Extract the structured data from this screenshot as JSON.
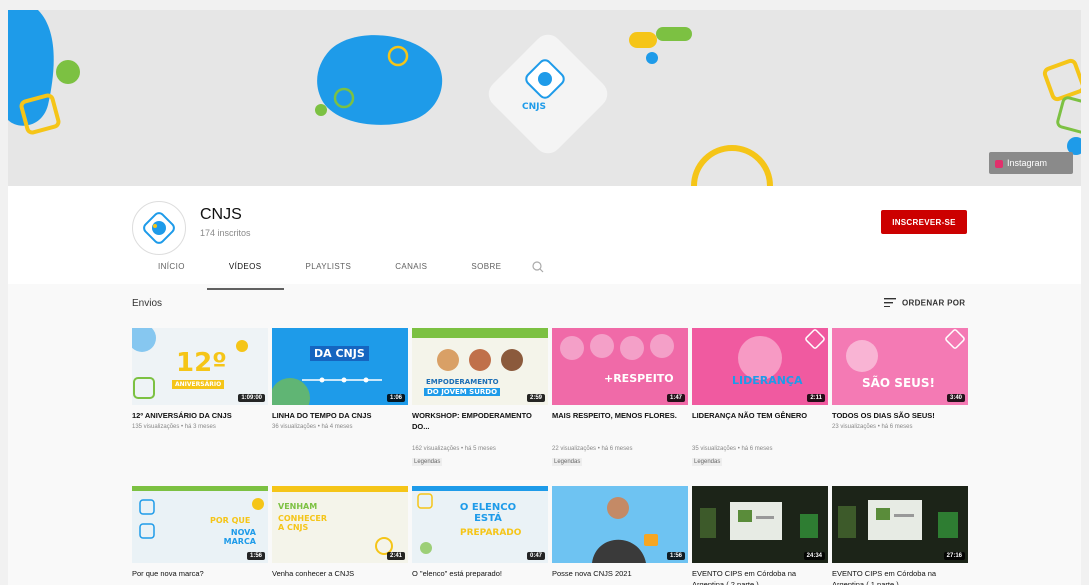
{
  "banner": {
    "logo_text": "CNJS",
    "instagram_label": "Instagram"
  },
  "channel": {
    "name": "CNJS",
    "subscribers": "174 inscritos",
    "subscribe_label": "INSCREVER-SE"
  },
  "tabs": [
    "INÍCIO",
    "VÍDEOS",
    "PLAYLISTS",
    "CANAIS",
    "SOBRE"
  ],
  "section": {
    "title": "Envios",
    "sort_label": "ORDENAR POR"
  },
  "videos": [
    {
      "title": "12º ANIVERSÁRIO DA CNJS",
      "meta": "135 visualizações • há 3 meses",
      "duration": "1:09:00",
      "thumb_text": "12º",
      "thumb_sub": "ANIVERSÁRIO"
    },
    {
      "title": "LINHA DO TEMPO DA CNJS",
      "meta": "36 visualizações • há 4 meses",
      "duration": "1:06",
      "thumb_text": "DA CNJS"
    },
    {
      "title": "WORKSHOP: EMPODERAMENTO DO...",
      "meta": "162 visualizações • há 5 meses",
      "duration": "2:59",
      "cc": "Legendas",
      "thumb_text": "EMPODERAMENTO",
      "thumb_sub": "DO JOVEM SURDO"
    },
    {
      "title": "MAIS RESPEITO, MENOS FLORES.",
      "meta": "22 visualizações • há 6 meses",
      "duration": "1:47",
      "cc": "Legendas",
      "thumb_text": "+RESPEITO"
    },
    {
      "title": "LIDERANÇA NÃO TEM GÊNERO",
      "meta": "35 visualizações • há 6 meses",
      "duration": "2:11",
      "cc": "Legendas",
      "thumb_text": "LIDERANÇA"
    },
    {
      "title": "TODOS OS DIAS SÃO SEUS!",
      "meta": "23 visualizações • há 6 meses",
      "duration": "3:40",
      "thumb_text": "SÃO SEUS!"
    },
    {
      "title": "Por que nova marca?",
      "meta": "",
      "duration": "1:56",
      "thumb_text": "POR QUE",
      "thumb_sub": "NOVA MARCA"
    },
    {
      "title": "Venha conhecer a CNJS",
      "meta": "",
      "duration": "2:41",
      "thumb_text": "VENHAM",
      "thumb_sub": "CONHECER A CNJS"
    },
    {
      "title": "O \"elenco\" está preparado!",
      "meta": "",
      "duration": "0:47",
      "thumb_text": "O ELENCO ESTÁ",
      "thumb_sub": "PREPARADO"
    },
    {
      "title": "Posse nova CNJS 2021",
      "meta": "",
      "duration": "1:56"
    },
    {
      "title": "EVENTO CIPS em Córdoba na Argentina ( 2 parte )",
      "meta": "",
      "duration": "24:34"
    },
    {
      "title": "EVENTO CIPS em Córdoba na Argentina ( 1 parte )",
      "meta": "",
      "duration": "27:16"
    }
  ],
  "colors": {
    "brand_blue": "#1e9be9",
    "brand_yellow": "#f5c518",
    "brand_green": "#7cc142",
    "subscribe_red": "#cc0000",
    "pink": "#f0529a"
  }
}
